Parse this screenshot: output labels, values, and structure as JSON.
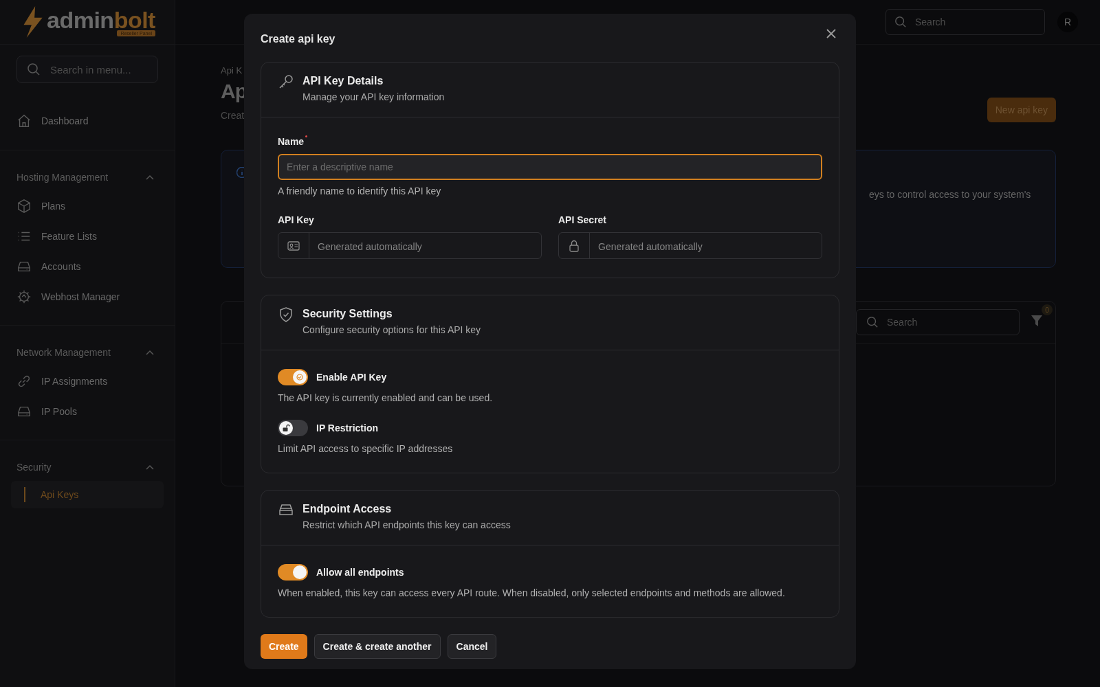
{
  "logo": {
    "part_1": "admin",
    "part_2": "bolt",
    "badge": "Reseller Panel"
  },
  "sidebar": {
    "search": {
      "placeholder": "Search in menu..."
    },
    "sections": [
      {
        "items": [
          {
            "label": "Dashboard",
            "selected": false
          }
        ]
      },
      {
        "title": "Hosting Management",
        "expanded": true,
        "items": [
          {
            "label": "Plans",
            "selected": false
          },
          {
            "label": "Feature Lists",
            "selected": false
          },
          {
            "label": "Accounts",
            "selected": false
          },
          {
            "label": "Webhost Manager",
            "selected": false
          }
        ]
      },
      {
        "title": "Network Management",
        "expanded": true,
        "items": [
          {
            "label": "IP Assignments",
            "selected": false
          },
          {
            "label": "IP Pools",
            "selected": false
          }
        ]
      },
      {
        "title": "Security",
        "expanded": true,
        "items": [
          {
            "label": "Api Keys",
            "selected": true
          }
        ]
      }
    ]
  },
  "topbar": {
    "search": {
      "placeholder": "Search"
    },
    "avatar": "R"
  },
  "page": {
    "breadcrumb": "Api K",
    "title": "Ap",
    "subtitle": "Creat",
    "new_button": "New api key",
    "info_text": "eys to control access to your system's",
    "table": {
      "search": {
        "placeholder": "Search"
      },
      "filter_count": "0"
    }
  },
  "modal": {
    "title": "Create api key",
    "details": {
      "title": "API Key Details",
      "subtitle": "Manage your API key information",
      "name": {
        "label": "Name",
        "required": true,
        "placeholder": "Enter a descriptive name",
        "hint": "A friendly name to identify this API key"
      },
      "api_key": {
        "label": "API Key",
        "placeholder": "Generated automatically"
      },
      "api_secret": {
        "label": "API Secret",
        "placeholder": "Generated automatically"
      }
    },
    "security": {
      "title": "Security Settings",
      "subtitle": "Configure security options for this API key",
      "toggles": [
        {
          "label": "Enable API Key",
          "description": "The API key is currently enabled and can be used.",
          "on": true
        },
        {
          "label": "IP Restriction",
          "description": "Limit API access to specific IP addresses",
          "on": false
        }
      ]
    },
    "endpoints": {
      "title": "Endpoint Access",
      "subtitle": "Restrict which API endpoints this key can access",
      "toggles": [
        {
          "label": "Allow all endpoints",
          "description": "When enabled, this key can access every API route. When disabled, only selected endpoints and methods are allowed.",
          "on": true
        }
      ]
    },
    "buttons": [
      {
        "label": "Create",
        "kind": "primary"
      },
      {
        "label": "Create & create another",
        "kind": "secondary"
      },
      {
        "label": "Cancel",
        "kind": "secondary"
      }
    ]
  }
}
